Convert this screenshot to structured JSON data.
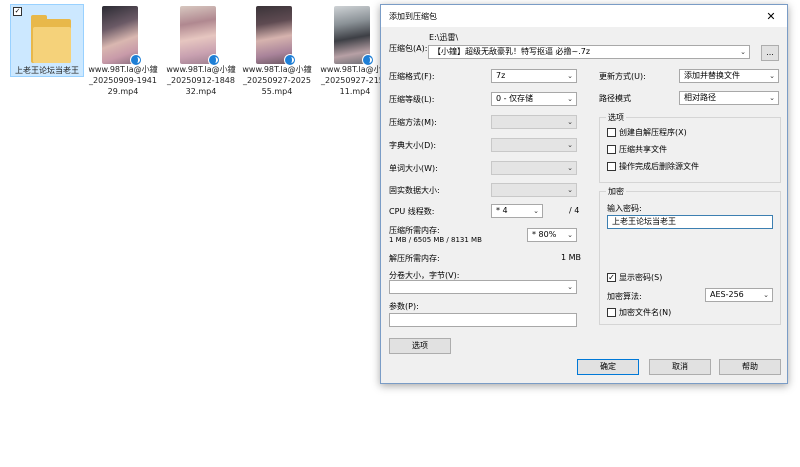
{
  "explorer": {
    "files": [
      {
        "name": "上老王论坛当老王",
        "type": "folder"
      },
      {
        "name": "www.98T.la@小鐘_20250909-194129.mp4",
        "type": "video"
      },
      {
        "name": "www.98T.la@小鐘_20250912-184832.mp4",
        "type": "video"
      },
      {
        "name": "www.98T.la@小鐘_20250927-202555.mp4",
        "type": "video"
      },
      {
        "name": "www.98T.la@小鐘_20250927-215911.mp4",
        "type": "video"
      }
    ]
  },
  "dialog": {
    "title": "添加到压缩包",
    "close": "✕",
    "archive_label": "压缩包(A):",
    "archive_path": "E:\\迅雷\\",
    "archive_name": "【小鐘】超级无敌豪乳！特写抠逼 必撸~.7z",
    "browse_button": "...",
    "format_label": "压缩格式(F):",
    "format_value": "7z",
    "level_label": "压缩等级(L):",
    "level_value": "0 - 仅存储",
    "method_label": "压缩方法(M):",
    "dict_label": "字典大小(D):",
    "word_label": "单词大小(W):",
    "solid_label": "固实数据大小:",
    "cpu_label": "CPU 线程数:",
    "cpu_value": "* 4",
    "cpu_total": "/ 4",
    "mem_comp_label": "压缩所需内存:",
    "mem_comp_detail": "1 MB / 6505 MB / 8131 MB",
    "mem_comp_value": "* 80%",
    "mem_decomp_label": "解压所需内存:",
    "mem_decomp_value": "1 MB",
    "split_label": "分卷大小，字节(V):",
    "params_label": "参数(P):",
    "options_button": "选项",
    "update_label": "更新方式(U):",
    "update_value": "添加并替换文件",
    "path_mode_label": "路径模式",
    "path_mode_value": "相对路径",
    "options_group": "选项",
    "opt_sfx": "创建自解压程序(X)",
    "opt_shared": "压缩共享文件",
    "opt_delete": "操作完成后删除源文件",
    "encrypt_group": "加密",
    "password_label": "输入密码:",
    "password_value": "上老王论坛当老王",
    "show_password": "显示密码(S)",
    "encrypt_method_label": "加密算法:",
    "encrypt_method_value": "AES-256",
    "encrypt_names": "加密文件名(N)",
    "ok_button": "确定",
    "cancel_button": "取消",
    "help_button": "帮助"
  },
  "colors": {
    "folder": "#e8b84a",
    "selection": "#cce8ff",
    "accent": "#0078d7"
  }
}
